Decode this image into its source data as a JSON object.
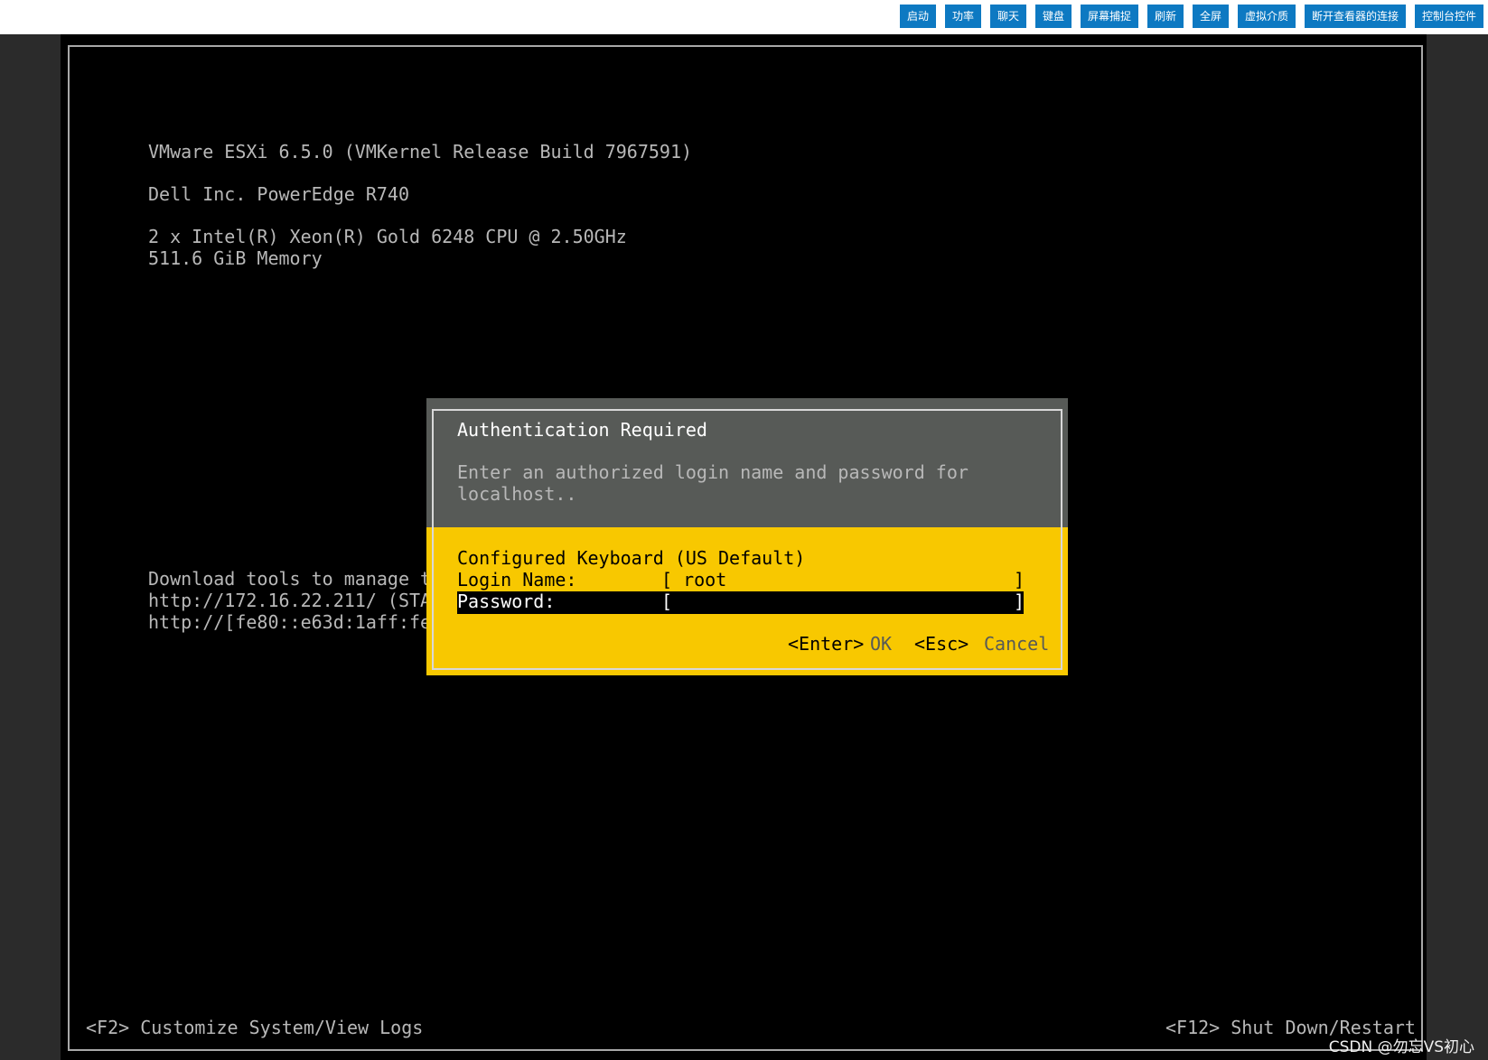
{
  "toolbar": {
    "buttons": [
      "启动",
      "功率",
      "聊天",
      "键盘",
      "屏幕捕捉",
      "刷新",
      "全屏",
      "虚拟介质",
      "断开查看器的连接",
      "控制台控件"
    ]
  },
  "console": {
    "line1": "VMware ESXi 6.5.0 (VMKernel Release Build 7967591)",
    "line2": "Dell Inc. PowerEdge R740",
    "line3": "2 x Intel(R) Xeon(R) Gold 6248 CPU @ 2.50GHz",
    "line4": "511.6 GiB Memory",
    "dl1": "Download tools to manage t",
    "dl2": "http://172.16.22.211/ (STA",
    "dl3": "http://[fe80::e63d:1aff:fe",
    "f2": "<F2> Customize System/View Logs",
    "f12": "<F12> Shut Down/Restart"
  },
  "dialog": {
    "title": "Authentication Required",
    "desc1": "Enter an authorized login name and password for",
    "desc2": "localhost..",
    "keyboard": "Configured Keyboard (US Default)",
    "login_label": "Login Name:",
    "login_value": "[ root",
    "login_close": "]",
    "password_label": "Password:",
    "password_value": "[",
    "password_close": "]",
    "enter_key": "<Enter>",
    "ok": "OK",
    "esc_key": "<Esc>",
    "cancel": "Cancel"
  },
  "watermark": "CSDN @勿忘VS初心",
  "colors": {
    "toolbar_button": "#0d79c2",
    "dialog_gray": "#575a57",
    "dialog_yellow": "#f8c800"
  }
}
